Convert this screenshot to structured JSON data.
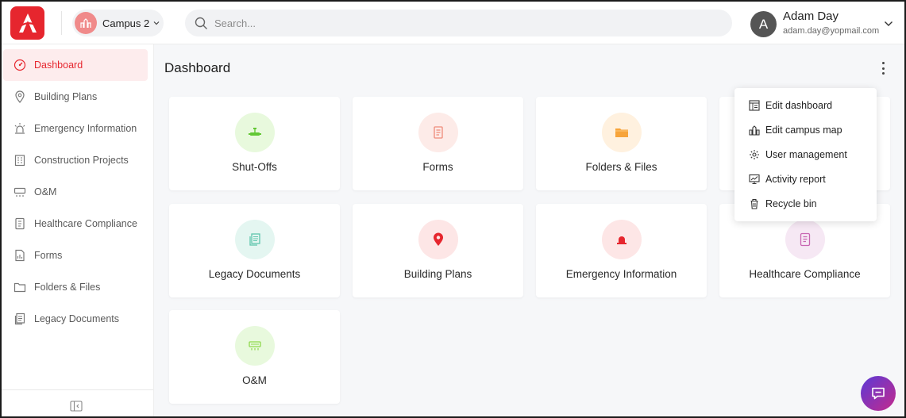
{
  "header": {
    "campus": {
      "name": "Campus 2"
    },
    "search": {
      "placeholder": "Search..."
    },
    "user": {
      "initial": "A",
      "name": "Adam Day",
      "email": "adam.day@yopmail.com"
    }
  },
  "sidebar": {
    "items": [
      {
        "label": "Dashboard",
        "icon": "gauge-icon",
        "active": true
      },
      {
        "label": "Building Plans",
        "icon": "map-pin-icon"
      },
      {
        "label": "Emergency Information",
        "icon": "alarm-light-icon"
      },
      {
        "label": "Construction Projects",
        "icon": "building-icon"
      },
      {
        "label": "O&M",
        "icon": "air-conditioner-icon"
      },
      {
        "label": "Healthcare Compliance",
        "icon": "notebook-icon"
      },
      {
        "label": "Forms",
        "icon": "form-icon"
      },
      {
        "label": "Folders & Files",
        "icon": "folder-icon"
      },
      {
        "label": "Legacy Documents",
        "icon": "documents-icon"
      }
    ]
  },
  "main": {
    "title": "Dashboard",
    "cards": [
      {
        "label": "Shut-Offs",
        "icon": "valve-icon",
        "bg": "#e8f9dd",
        "color": "#62c834"
      },
      {
        "label": "Forms",
        "icon": "form-icon",
        "bg": "#fdebe8",
        "color": "#ef8b7a"
      },
      {
        "label": "Folders & Files",
        "icon": "folder-icon",
        "bg": "#fff1df",
        "color": "#f7a43a"
      },
      {
        "label": "Legacy Documents",
        "icon": "documents-icon",
        "bg": "#e4f6f1",
        "color": "#5fc6ad"
      },
      {
        "label": "Building Plans",
        "icon": "map-pin-icon",
        "bg": "#fde6e6",
        "color": "#e6262e"
      },
      {
        "label": "Emergency Information",
        "icon": "alarm-light-icon",
        "bg": "#fde6e6",
        "color": "#e6262e"
      },
      {
        "label": "Healthcare Compliance",
        "icon": "notebook-icon",
        "bg": "#f6e8f4",
        "color": "#c866b2"
      },
      {
        "label": "O&M",
        "icon": "air-conditioner-icon",
        "bg": "#e8f9dd",
        "color": "#8ed94d"
      }
    ]
  },
  "menu": {
    "items": [
      {
        "label": "Edit dashboard",
        "icon": "dashboard-edit-icon"
      },
      {
        "label": "Edit campus map",
        "icon": "campus-map-icon"
      },
      {
        "label": "User management",
        "icon": "gear-icon"
      },
      {
        "label": "Activity report",
        "icon": "report-icon"
      },
      {
        "label": "Recycle bin",
        "icon": "trash-icon"
      }
    ]
  },
  "colors": {
    "brand": "#e6262e",
    "active_bg": "#fdeced",
    "chat_gradient_start": "#5b3ad6",
    "chat_gradient_end": "#c42a8c"
  }
}
